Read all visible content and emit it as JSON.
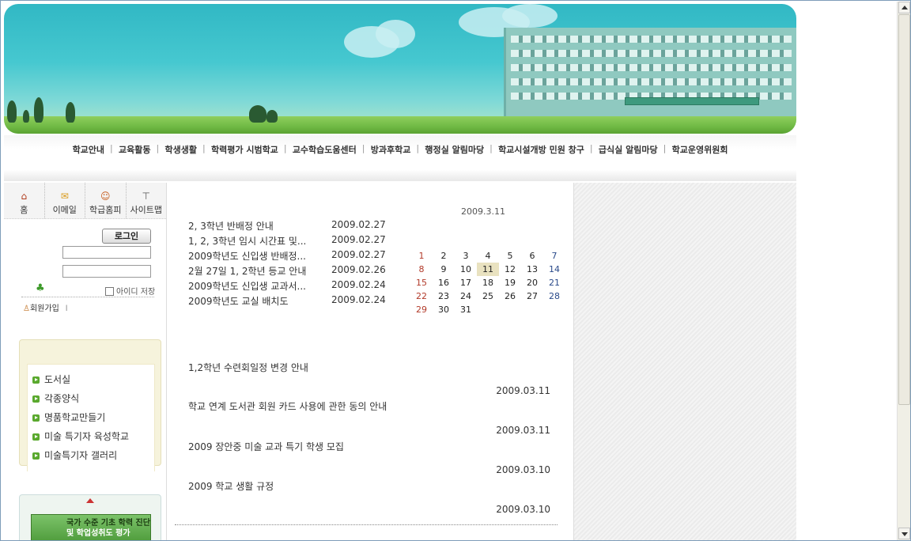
{
  "nav": {
    "items": [
      "학교안내",
      "교육활동",
      "학생생활",
      "학력평가 시범학교",
      "교수학습도움센터",
      "방과후학교",
      "행정실 알림마당",
      "학교시설개방 민원 창구",
      "급식실 알림마당",
      "학교운영위원회"
    ]
  },
  "quick": {
    "home": "홈",
    "email": "이메일",
    "class_home": "학급홈피",
    "sitemap": "사이트맵"
  },
  "login": {
    "button": "로그인",
    "id_value": "",
    "pw_value": "",
    "save_id": "아이디 저장",
    "join": "회원가입",
    "join_sep": "l"
  },
  "side_menu": {
    "items": [
      "도서실",
      "각종양식",
      "명품학교만들기",
      "미술 특기자 육성학교",
      "미술특기자 갤러리"
    ]
  },
  "side_banner": {
    "line1": "국가 수준 기초 학력 진단",
    "line2": "및 학업성취도 평가"
  },
  "notices": [
    {
      "title": "2, 3학년 반배정 안내",
      "date": "2009.02.27"
    },
    {
      "title": "1, 2, 3학년 임시 시간표 및...",
      "date": "2009.02.27"
    },
    {
      "title": "2009학년도 신입생 반배정...",
      "date": "2009.02.27"
    },
    {
      "title": "2월 27일 1, 2학년 등교 안내",
      "date": "2009.02.26"
    },
    {
      "title": "2009학년도 신입생 교과서...",
      "date": "2009.02.24"
    },
    {
      "title": "2009학년도 교실 배치도",
      "date": "2009.02.24"
    }
  ],
  "calendar": {
    "title": "2009.3.11",
    "today": "11",
    "weeks": [
      [
        "1",
        "2",
        "3",
        "4",
        "5",
        "6",
        "7"
      ],
      [
        "8",
        "9",
        "10",
        "11",
        "12",
        "13",
        "14"
      ],
      [
        "15",
        "16",
        "17",
        "18",
        "19",
        "20",
        "21"
      ],
      [
        "22",
        "23",
        "24",
        "25",
        "26",
        "27",
        "28"
      ],
      [
        "29",
        "30",
        "31",
        "",
        "",
        "",
        ""
      ]
    ]
  },
  "board": [
    {
      "title": "1,2학년 수련회일정 변경 안내",
      "date": "2009.03.11"
    },
    {
      "title": "학교 연계 도서관 회원 카드 사용에 관한 동의 안내",
      "date": "2009.03.11"
    },
    {
      "title": "2009 장안중 미술 교과 특기 학생 모집",
      "date": "2009.03.10"
    },
    {
      "title": "2009 학교 생활 규정",
      "date": "2009.03.10"
    }
  ],
  "colors": {
    "sky": "#46c8d0",
    "grass": "#6fb944",
    "sunday": "#b23a2a",
    "saturday": "#2a4a8a",
    "today_bg": "#e9e2c0",
    "menu_bullet": "#5aa92e"
  },
  "icons": {
    "home": "house-icon",
    "email": "envelope-icon",
    "class_home": "smiley-icon",
    "sitemap": "sitemap-tree-icon",
    "user": "user-icon",
    "bullet": "arrow-bullet-icon"
  }
}
